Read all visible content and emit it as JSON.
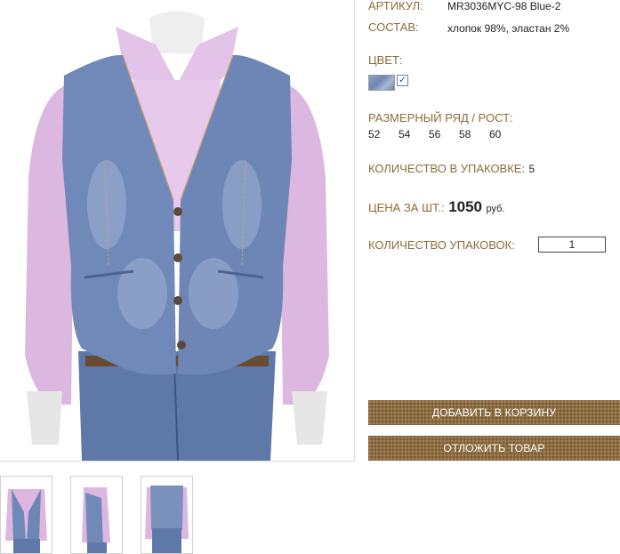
{
  "product": {
    "article_label": "АРТИКУЛ:",
    "article_value": "MR3036MYC-98 Blue-2",
    "composition_label": "СОСТАВ:",
    "composition_value": "хлопок 98%, эластан 2%",
    "color_label": "ЦВЕТ:",
    "color_check": "✓",
    "size_label": "РАЗМЕРНЫЙ РЯД / РОСТ:",
    "sizes": [
      "52",
      "54",
      "56",
      "58",
      "60"
    ],
    "pack_label": "КОЛИЧЕСТВО В УПАКОВКЕ:",
    "pack_value": "5",
    "price_label": "ЦЕНА ЗА ШТ.:",
    "price_value": "1050",
    "price_unit": "руб.",
    "packs_label": "КОЛИЧЕСТВО УПАКОВОК:",
    "packs_value": "1"
  },
  "buttons": {
    "add_to_cart": "ДОБАВИТЬ В КОРЗИНУ",
    "defer": "ОТЛОЖИТЬ ТОВАР"
  },
  "colors": {
    "label": "#8a6d3b",
    "button_bg": "#8b6a3e",
    "denim": "#7189b8",
    "shirt": "#dcb8e0"
  },
  "images": {
    "main": "denim-vest-photo",
    "thumbnails": [
      "thumb-front",
      "thumb-side",
      "thumb-back"
    ]
  }
}
